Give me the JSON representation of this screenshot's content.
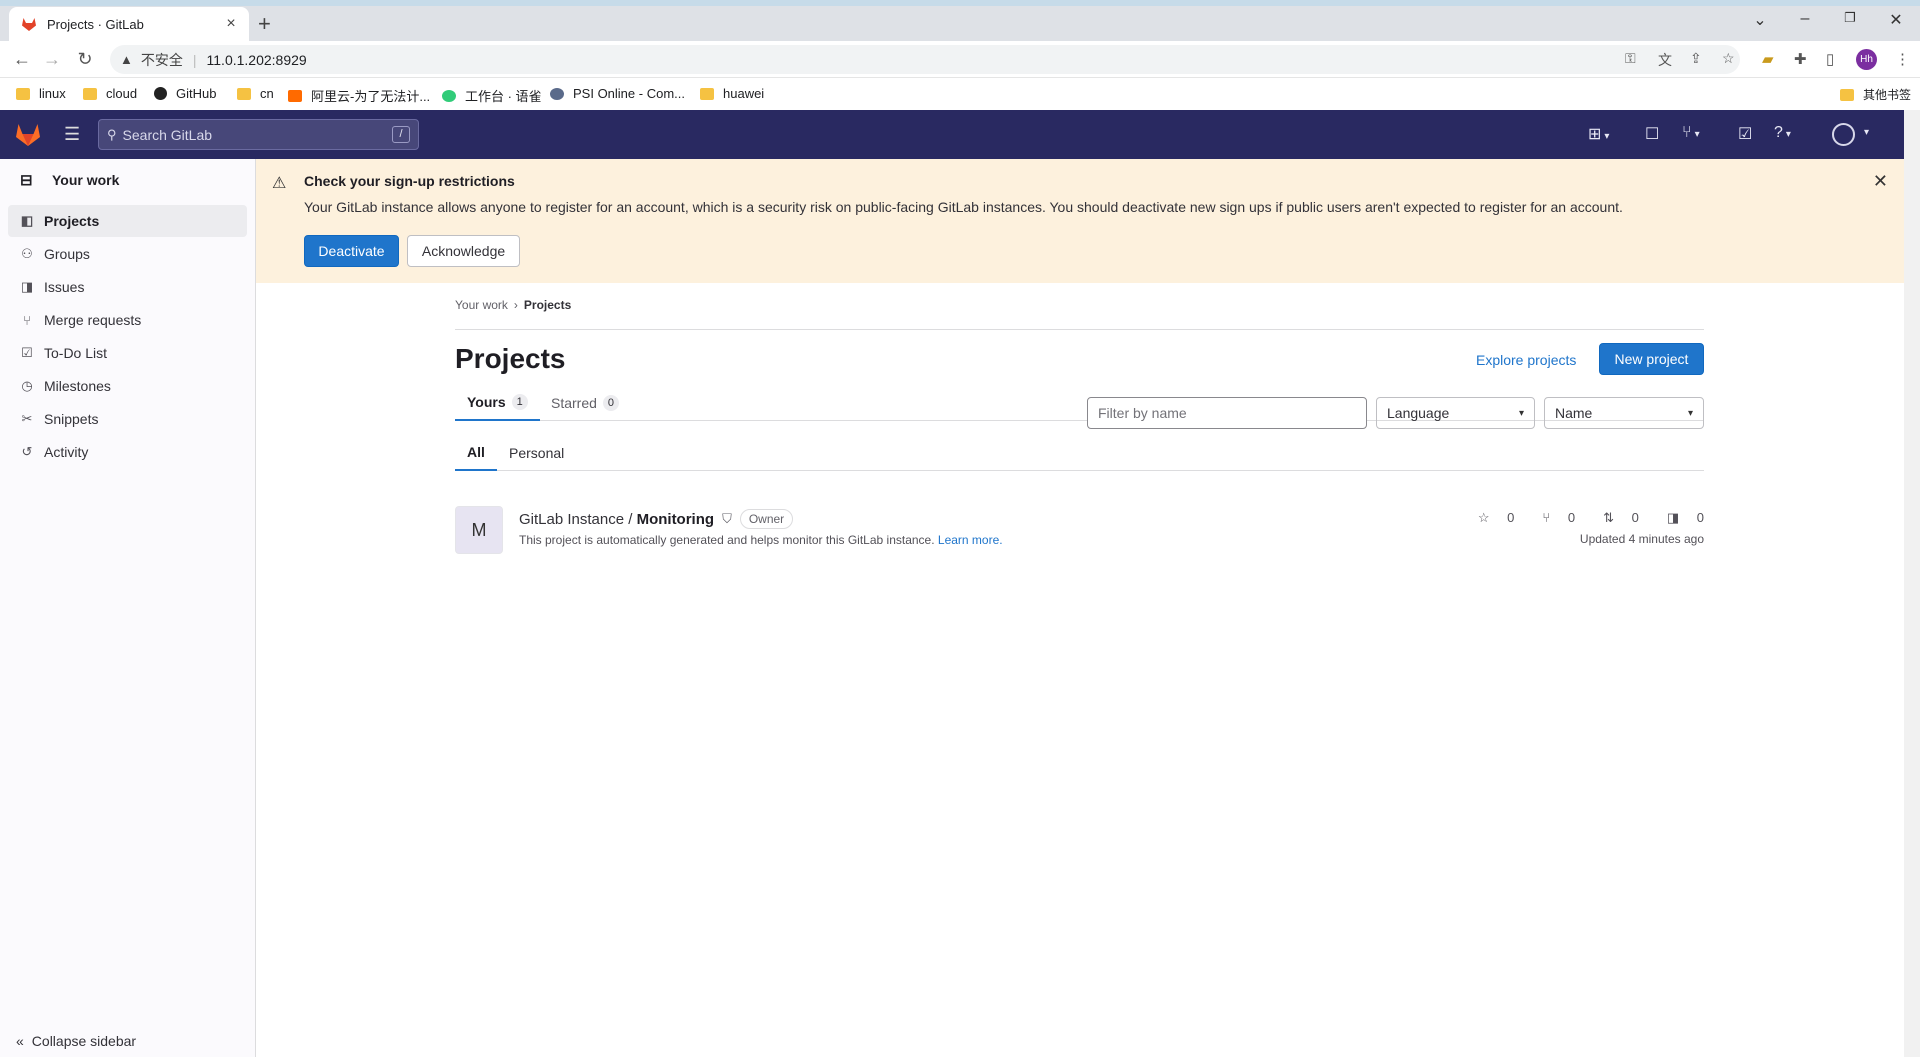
{
  "browser": {
    "tab_title": "Projects · GitLab",
    "insecure_label": "不安全",
    "url": "11.0.1.202:8929",
    "profile_initials": "Hh",
    "bookmarks": [
      "linux",
      "cloud",
      "GitHub",
      "cn",
      "阿里云-为了无法计...",
      "工作台 · 语雀",
      "PSI Online - Com...",
      "huawei"
    ],
    "other_bookmarks": "其他书签"
  },
  "header": {
    "search_placeholder": "Search GitLab",
    "search_shortcut": "/"
  },
  "sidebar": {
    "context": "Your work",
    "items": [
      {
        "label": "Projects",
        "icon": "project-icon",
        "active": true
      },
      {
        "label": "Groups",
        "icon": "group-icon"
      },
      {
        "label": "Issues",
        "icon": "issues-icon"
      },
      {
        "label": "Merge requests",
        "icon": "merge-request-icon"
      },
      {
        "label": "To-Do List",
        "icon": "todo-icon"
      },
      {
        "label": "Milestones",
        "icon": "milestone-icon"
      },
      {
        "label": "Snippets",
        "icon": "snippet-icon"
      },
      {
        "label": "Activity",
        "icon": "history-icon"
      }
    ],
    "collapse_label": "Collapse sidebar"
  },
  "alert": {
    "title": "Check your sign-up restrictions",
    "message": "Your GitLab instance allows anyone to register for an account, which is a security risk on public-facing GitLab instances. You should deactivate new sign ups if public users aren't expected to register for an account.",
    "deactivate_label": "Deactivate",
    "acknowledge_label": "Acknowledge"
  },
  "main": {
    "breadcrumb": [
      "Your work",
      "Projects"
    ],
    "title": "Projects",
    "explore_label": "Explore projects",
    "new_project_label": "New project",
    "tabs": [
      {
        "label": "Yours",
        "count": "1"
      },
      {
        "label": "Starred",
        "count": "0"
      }
    ],
    "filter_placeholder": "Filter by name",
    "language_label": "Language",
    "sort_label": "Name",
    "subtabs": [
      "All",
      "Personal"
    ],
    "projects": [
      {
        "avatar_letter": "M",
        "namespace": "GitLab Instance / ",
        "name": "Monitoring",
        "role": "Owner",
        "description": "This project is automatically generated and helps monitor this GitLab instance.",
        "learn_more": "Learn more.",
        "stars": "0",
        "forks": "0",
        "merge_requests": "0",
        "issues": "0",
        "updated": "Updated 4 minutes ago"
      }
    ]
  },
  "colors": {
    "header_bg": "#292961",
    "alert_bg": "#fdf1dd",
    "primary": "#1f75cb"
  }
}
